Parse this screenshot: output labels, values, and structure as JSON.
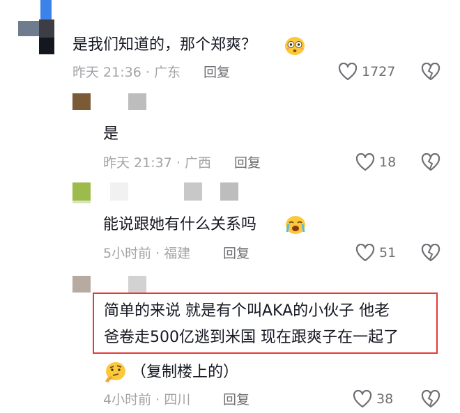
{
  "comments": [
    {
      "text": "是我们知道的，那个郑爽？",
      "emoji": "flushed-face",
      "time": "昨天 21:36",
      "location": "广东",
      "reply_label": "回复",
      "likes": "1727"
    },
    {
      "text": "是",
      "time": "昨天 21:37",
      "location": "广西",
      "reply_label": "回复",
      "likes": "18"
    },
    {
      "text": "能说跟她有什么关系吗",
      "emoji": "crying-face",
      "time": "5小时前",
      "location": "福建",
      "reply_label": "回复",
      "likes": "51"
    },
    {
      "text_lines": [
        "简单的来说 就是有个叫AKA的小伙子 他老",
        "爸卷走500亿逃到米国 现在跟爽子在一起了"
      ],
      "extra_text": "（复制楼上的）",
      "emoji": "thinking-face",
      "time": "4小时前",
      "location": "四川",
      "reply_label": "回复",
      "likes": "38"
    }
  ],
  "separator": "·",
  "colors": {
    "highlight_border": "#e53935",
    "meta": "#a3a3a8",
    "icon": "#6e6e73"
  }
}
